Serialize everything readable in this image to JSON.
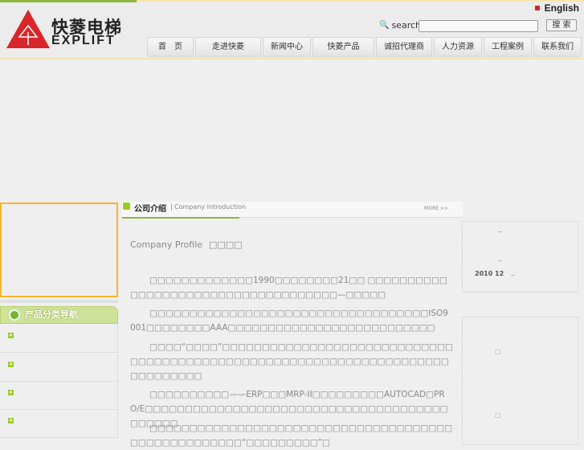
{
  "header": {
    "logo_cn": "快菱电梯",
    "logo_en": "EXPLIFT",
    "english_link": "English",
    "search_label": "search",
    "search_value": "",
    "search_button": "搜 索"
  },
  "nav": [
    "首　页",
    "走进快菱",
    "新闻中心",
    "快菱产品",
    "诚招代理商",
    "人力资源",
    "工程案例",
    "联系我们"
  ],
  "left": {
    "category_title": "产品分类导航",
    "categories": [
      "",
      "",
      "",
      ""
    ]
  },
  "intro": {
    "title": "公司介绍",
    "subtitle": "Company Introduction",
    "more": "MORE >>",
    "profile_en": "Company Profile",
    "profile_cn": "□□□□",
    "paragraphs": [
      "□□□□□□□□□□□□□1990□□□□□□□□21□□ □□□□□□□□□□□□□□□□□□□□□□□□□□□□□□□□□□□□—□□□□□",
      "□□□□□□□□□□□□□□□□□□□□□□□□□□□□□□□□□□□ISO9001□□□□□□□□AAA□□□□□□□□□□□□□□□□□□□□□□□□□□",
      "□□□□“□□□□”□□□□□□□□□□□□□□□□□□□□□□□□□□□□□□□□□□□□□□□□□□□□□□□□□□□□□□□□□□□□□□□□□□□□□□□□□□□□□□",
      "□□□□□□□□□□——ERP□□□MRP-II□□□□□□□□□AUTOCAD□PRO/E□□□□□□□□□□□□□□□□□□□□□□□□□□□□□□□□□□□□□□□□□□□□",
      "□□□□□□□□□□□□□□□□□□□□□□□□□□□□□□□□□□□□□□□□□□□□□□□□□□□□“□□□□□□□□□”□"
    ]
  },
  "right": {
    "news_marks": [
      "..",
      "..",
      ".."
    ],
    "news_date": "2010 12",
    "box2_marks": [
      "□",
      "□"
    ]
  }
}
